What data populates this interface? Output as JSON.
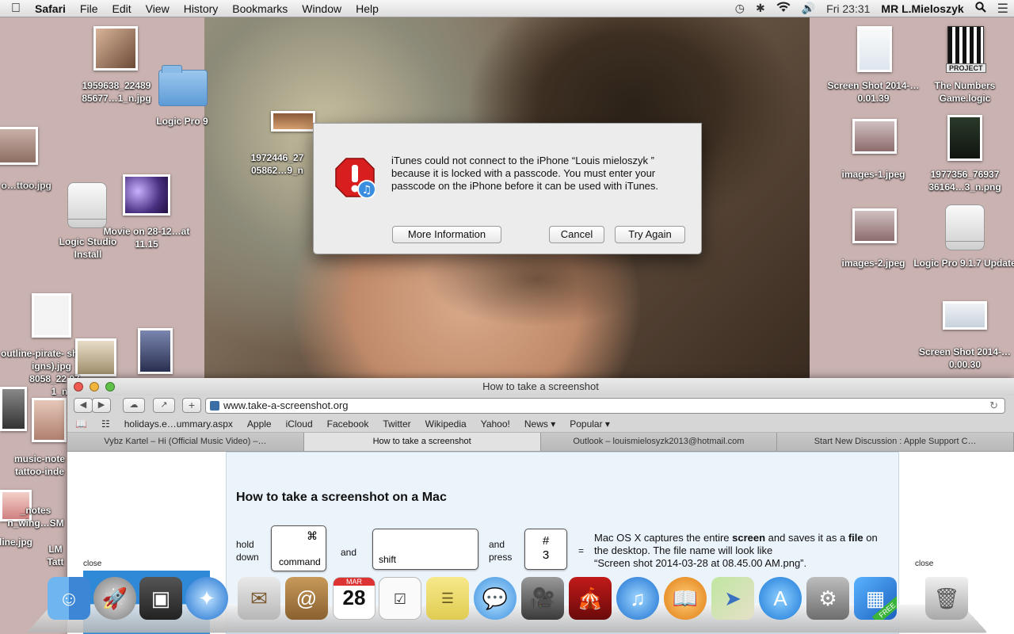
{
  "menubar": {
    "apple": "",
    "items": [
      "Safari",
      "File",
      "Edit",
      "View",
      "History",
      "Bookmarks",
      "Window",
      "Help"
    ],
    "status": {
      "clock": "Fri 23:31",
      "user": "MR L.Mieloszyk"
    }
  },
  "desktop": {
    "icons": [
      {
        "label": "1959638_22489 85677…1_n.jpg"
      },
      {
        "label": "Logic Pro 9"
      },
      {
        "label": "1972446_27 05862…9_n"
      },
      {
        "label": "v-sweet- o…ttoo.jpg"
      },
      {
        "label": "Logic Studio Install"
      },
      {
        "label": "Movie on 28-12…at 11.15"
      },
      {
        "label": "outline-pirate- ship-t…igns).jpg"
      },
      {
        "label": "8058_22 07…1_n"
      },
      {
        "label": "music-note tattoo-inde"
      },
      {
        "label": "_notes n_wing…SM"
      },
      {
        "label": "line.jpg"
      },
      {
        "label": "LM Tatt"
      },
      {
        "label": "Screen Shot 2014-…0.01.39"
      },
      {
        "label": "The Numbers Game.logic"
      },
      {
        "label": "images-1.jpeg"
      },
      {
        "label": "1977356_76937 36164…3_n.png"
      },
      {
        "label": "images-2.jpeg"
      },
      {
        "label": "Logic Pro 9.1.7 Update"
      },
      {
        "label": "Screen Shot 2014-…0.00.30"
      }
    ],
    "project_badge": "PROJECT"
  },
  "alert": {
    "message": "iTunes could not connect to the iPhone “Louis mieloszyk ” because it is locked with a passcode. You must enter your passcode on the iPhone before it can be used with iTunes.",
    "buttons": {
      "more_info": "More Information",
      "cancel": "Cancel",
      "try_again": "Try Again"
    }
  },
  "safari": {
    "title": "How to take a screenshot",
    "url": "www.take-a-screenshot.org",
    "favorites": [
      "holidays.e…ummary.aspx",
      "Apple",
      "iCloud",
      "Facebook",
      "Twitter",
      "Wikipedia",
      "Yahoo!",
      "News ▾",
      "Popular ▾"
    ],
    "tabs": [
      {
        "label": "Vybz Kartel – Hi (Official Music Video) –…"
      },
      {
        "label": "How to take a screenshot"
      },
      {
        "label": "Outlook – louismielosyzk2013@hotmail.com"
      },
      {
        "label": "Start New Discussion : Apple Support C…"
      }
    ],
    "page": {
      "heading": "How to take a screenshot on a Mac",
      "hold_down": "hold down",
      "and1": "and",
      "and_press": "and press",
      "equals": "=",
      "key_command_symbol": "⌘",
      "key_command": "command",
      "key_shift": "shift",
      "key_hash": "#",
      "key_three": "3",
      "desc_line1_a": "Mac OS X captures the entire ",
      "desc_line1_b": "screen",
      "desc_line1_c": " and saves it as a ",
      "desc_line1_d": "file",
      "desc_line1_e": " on",
      "desc_line2": "the desktop. The file name will look like",
      "desc_line3": "“Screen shot 2014-03-28 at 08.45.00 AM.png”."
    },
    "ads": {
      "close_left": "close",
      "close_right": "close"
    }
  },
  "dock": {
    "calendar_month": "MAR",
    "calendar_day": "28",
    "free_badge": "FREE"
  }
}
